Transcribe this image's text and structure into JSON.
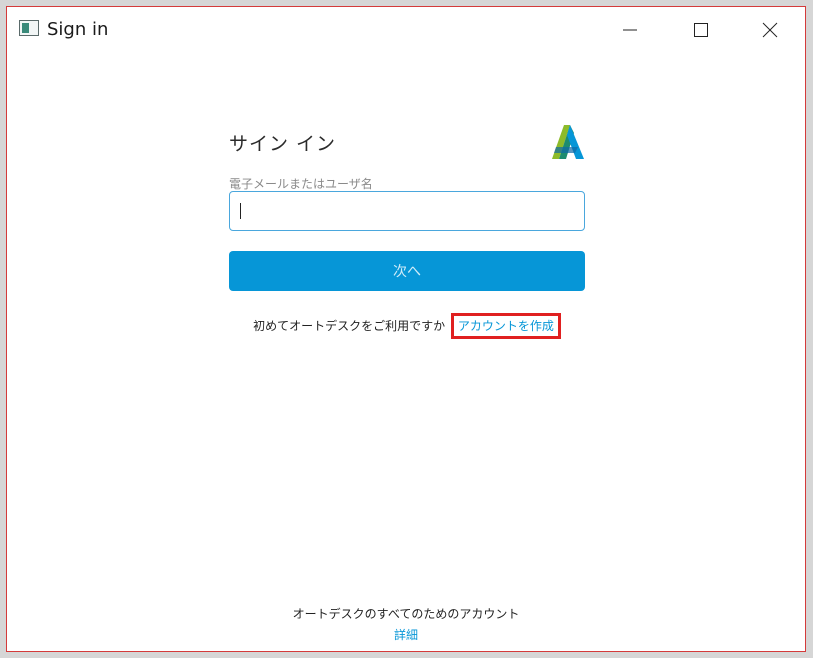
{
  "window": {
    "title": "Sign in"
  },
  "form": {
    "heading": "サイン イン",
    "field_label": "電子メールまたはユーザ名",
    "input_value": "",
    "next_label": "次へ",
    "signup_prompt": "初めてオートデスクをご利用ですか",
    "signup_link": "アカウントを作成"
  },
  "footer": {
    "tagline": "オートデスクのすべてのためのアカウント",
    "details_link": "詳細"
  },
  "colors": {
    "accent": "#0696d7",
    "highlight_box": "#e02020",
    "logo": [
      "#8dbb2a",
      "#1d8c6f",
      "#0696d7"
    ]
  },
  "icons": [
    "app-window-icon",
    "minimize-icon",
    "maximize-icon",
    "close-icon",
    "autodesk-logo-icon"
  ]
}
